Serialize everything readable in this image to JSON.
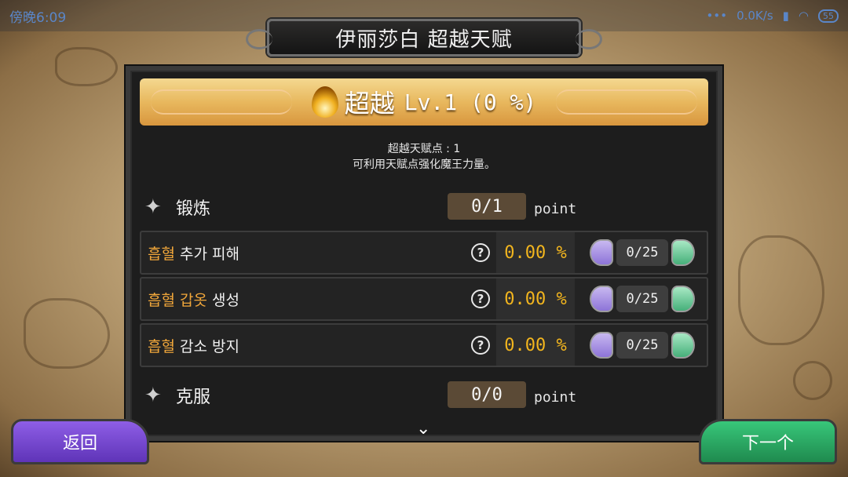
{
  "status_bar": {
    "time": "傍晚6:09",
    "network_speed": "0.0K/s",
    "battery": "55"
  },
  "header": {
    "title": "伊丽莎白 超越天赋"
  },
  "banner": {
    "name": "超越",
    "level_text": "Lv.1 (0 %)"
  },
  "info": {
    "points_line": "超越天赋点 : 1",
    "hint_line": "可利用天赋点强化魔王力量。"
  },
  "sections": [
    {
      "name": "锻炼",
      "points": "0/1",
      "unit": "point",
      "rows": [
        {
          "highlight": "흡혈",
          "name": "추가 피해",
          "value": "0.00 %",
          "count": "0/25"
        },
        {
          "highlight": "흡혈 갑옷",
          "name": "생성",
          "value": "0.00 %",
          "count": "0/25"
        },
        {
          "highlight": "흡혈",
          "name": "감소 방지",
          "value": "0.00 %",
          "count": "0/25"
        }
      ]
    },
    {
      "name": "克服",
      "points": "0/0",
      "unit": "point"
    }
  ],
  "buttons": {
    "back": "返回",
    "next": "下一个"
  },
  "colors": {
    "highlight": "#f0a63a",
    "value": "#f2b51e",
    "back_button": "#7b4ad6",
    "next_button": "#2daa63"
  }
}
